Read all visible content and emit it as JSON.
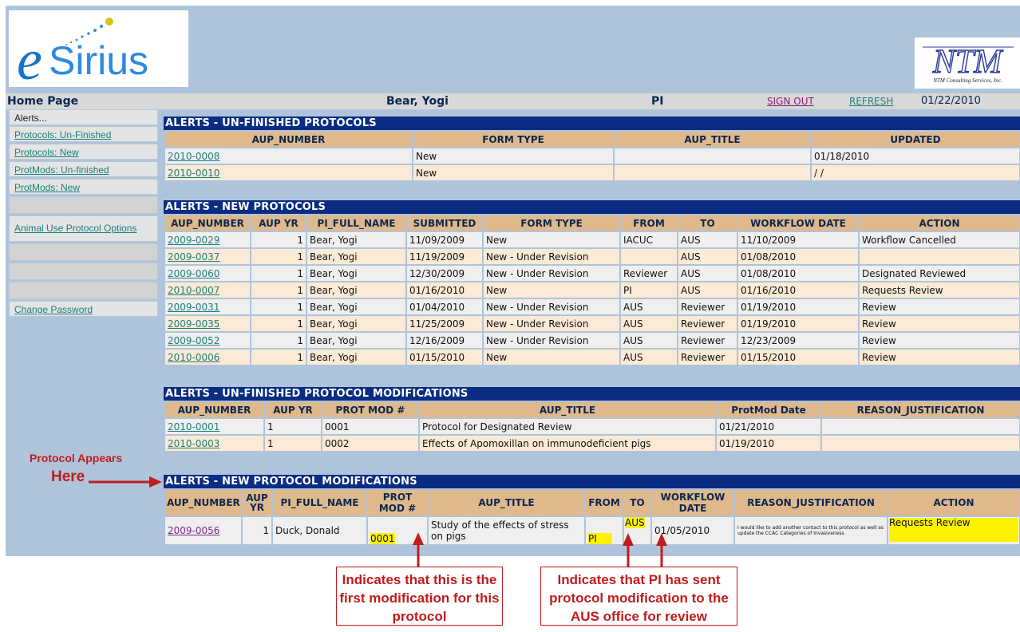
{
  "header": {
    "logo_text": "eSirius",
    "ntm_logo_text": "NTM",
    "ntm_caption": "NTM Consulting Services, Inc.",
    "page_title": "Home Page",
    "user_name": "Bear, Yogi",
    "role": "PI",
    "sign_out": "SIGN OUT",
    "refresh": "REFRESH",
    "date": "01/22/2010"
  },
  "sidebar": {
    "heading": "Alerts...",
    "items": [
      {
        "label": "Protocols: Un-Finished"
      },
      {
        "label": "Protocols: New"
      },
      {
        "label": "ProtMods: Un-finished"
      },
      {
        "label": "ProtMods: New"
      },
      {
        "label": "Animal Use Protocol Options"
      },
      {
        "label": "Change Password"
      }
    ]
  },
  "unfinished_protocols": {
    "title": "ALERTS - UN-FINISHED PROTOCOLS",
    "columns": [
      "AUP_NUMBER",
      "FORM TYPE",
      "AUP_TITLE",
      "UPDATED"
    ],
    "rows": [
      {
        "aup_number": "2010-0008",
        "form_type": "New",
        "aup_title": "",
        "updated": "01/18/2010"
      },
      {
        "aup_number": "2010-0010",
        "form_type": "New",
        "aup_title": "",
        "updated": "/ /"
      }
    ]
  },
  "new_protocols": {
    "title": "ALERTS - NEW PROTOCOLS",
    "columns": [
      "AUP_NUMBER",
      "AUP YR",
      "PI_FULL_NAME",
      "SUBMITTED",
      "FORM TYPE",
      "FROM",
      "TO",
      "WORKFLOW DATE",
      "ACTION"
    ],
    "rows": [
      {
        "aup_number": "2009-0029",
        "yr": "1",
        "pi": "Bear, Yogi",
        "submitted": "11/09/2009",
        "form_type": "New",
        "from": "IACUC",
        "to": "AUS",
        "wf_date": "11/10/2009",
        "action": "Workflow Cancelled"
      },
      {
        "aup_number": "2009-0037",
        "yr": "1",
        "pi": "Bear, Yogi",
        "submitted": "11/19/2009",
        "form_type": "New - Under Revision",
        "from": "",
        "to": "AUS",
        "wf_date": "01/08/2010",
        "action": ""
      },
      {
        "aup_number": "2009-0060",
        "yr": "1",
        "pi": "Bear, Yogi",
        "submitted": "12/30/2009",
        "form_type": "New - Under Revision",
        "from": "Reviewer",
        "to": "AUS",
        "wf_date": "01/08/2010",
        "action": "Designated Reviewed"
      },
      {
        "aup_number": "2010-0007",
        "yr": "1",
        "pi": "Bear, Yogi",
        "submitted": "01/16/2010",
        "form_type": "New",
        "from": "PI",
        "to": "AUS",
        "wf_date": "01/16/2010",
        "action": "Requests Review"
      },
      {
        "aup_number": "2009-0031",
        "yr": "1",
        "pi": "Bear, Yogi",
        "submitted": "01/04/2010",
        "form_type": "New - Under Revision",
        "from": "AUS",
        "to": "Reviewer",
        "wf_date": "01/19/2010",
        "action": "Review"
      },
      {
        "aup_number": "2009-0035",
        "yr": "1",
        "pi": "Bear, Yogi",
        "submitted": "11/25/2009",
        "form_type": "New - Under Revision",
        "from": "AUS",
        "to": "Reviewer",
        "wf_date": "01/19/2010",
        "action": "Review"
      },
      {
        "aup_number": "2009-0052",
        "yr": "1",
        "pi": "Bear, Yogi",
        "submitted": "12/16/2009",
        "form_type": "New - Under Revision",
        "from": "AUS",
        "to": "Reviewer",
        "wf_date": "12/23/2009",
        "action": "Review"
      },
      {
        "aup_number": "2010-0006",
        "yr": "1",
        "pi": "Bear, Yogi",
        "submitted": "01/15/2010",
        "form_type": "New",
        "from": "AUS",
        "to": "Reviewer",
        "wf_date": "01/15/2010",
        "action": "Review"
      }
    ]
  },
  "unfinished_mods": {
    "title": "ALERTS - UN-FINISHED PROTOCOL MODIFICATIONS",
    "columns": [
      "AUP_NUMBER",
      "AUP YR",
      "PROT MOD #",
      "AUP_TITLE",
      "ProtMod Date",
      "REASON_JUSTIFICATION"
    ],
    "rows": [
      {
        "aup_number": "2010-0001",
        "yr": "1",
        "mod": "0001",
        "aup_title": "Protocol for Designated Review",
        "date": "01/21/2010",
        "reason": ""
      },
      {
        "aup_number": "2010-0003",
        "yr": "1",
        "mod": "0002",
        "aup_title": "Effects of Apomoxillan on immunodeficient pigs",
        "date": "01/19/2010",
        "reason": ""
      }
    ]
  },
  "new_mods": {
    "title": "ALERTS - NEW PROTOCOL MODIFICATIONS",
    "columns": [
      "AUP_NUMBER",
      "AUP YR",
      "PI_FULL_NAME",
      "PROT MOD #",
      "AUP_TITLE",
      "FROM",
      "TO",
      "WORKFLOW DATE",
      "REASON_JUSTIFICATION",
      "ACTION"
    ],
    "rows": [
      {
        "aup_number": "2009-0056",
        "yr": "1",
        "pi": "Duck, Donald",
        "mod": "0001",
        "aup_title": "Study of the effects of stress on pigs",
        "from": "PI",
        "to": "AUS",
        "wf_date": "01/05/2010",
        "reason": "I would like to add another contact to this protocol as well as update the CCAC Categories of Invasiveness",
        "action": "Requests Review"
      }
    ]
  },
  "annotations": {
    "left_label_1": "Protocol Appears",
    "left_label_2": "Here",
    "callout_1": "Indicates that this is the first modification for this protocol",
    "callout_2": "Indicates that PI has sent protocol modification to the AUS office for review"
  },
  "colors": {
    "page_bg": "#afc4db",
    "section_bar": "#0a2c82",
    "header_cell": "#dfb98c",
    "row_gray": "#efefef",
    "row_peach": "#fbead6",
    "highlight": "#fff200",
    "annotation_red": "#c21c1c",
    "link": "#1d7f7a"
  }
}
